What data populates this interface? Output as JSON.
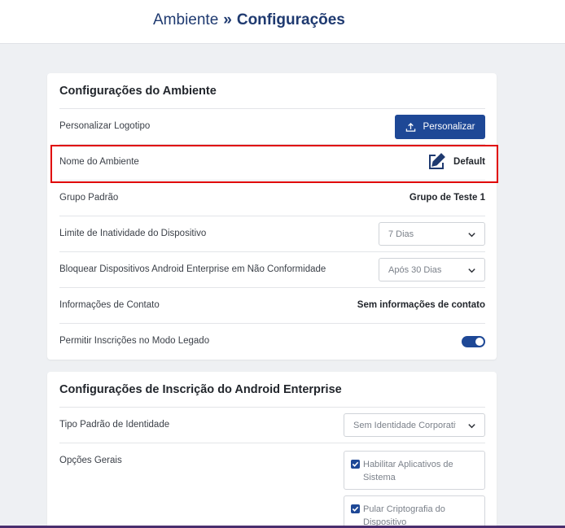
{
  "header": {
    "breadcrumb_parent": "Ambiente",
    "breadcrumb_separator": "»",
    "breadcrumb_current": "Configurações"
  },
  "environment_settings": {
    "title": "Configurações do Ambiente",
    "rows": {
      "logo": {
        "label": "Personalizar Logotipo",
        "button": "Personalizar",
        "icon": "upload-icon"
      },
      "name": {
        "label": "Nome do Ambiente",
        "value": "Default",
        "icon": "edit-icon"
      },
      "group": {
        "label": "Grupo Padrão",
        "value": "Grupo de Teste 1"
      },
      "inactivity": {
        "label": "Limite de Inatividade do Dispositivo",
        "selected": "7 Dias"
      },
      "block": {
        "label": "Bloquear Dispositivos Android Enterprise em Não Conformidade",
        "selected": "Após 30 Dias"
      },
      "contact": {
        "label": "Informações de Contato",
        "value": "Sem informações de contato"
      },
      "legacy": {
        "label": "Permitir Inscrições no Modo Legado",
        "toggle_on": true
      }
    }
  },
  "android_enrollment": {
    "title": "Configurações de Inscrição do Android Enterprise",
    "rows": {
      "identity": {
        "label": "Tipo Padrão de Identidade",
        "selected": "Sem Identidade Corporativa"
      },
      "general": {
        "label": "Opções Gerais",
        "options": [
          {
            "label": "Habilitar Aplicativos de Sistema",
            "checked": true
          },
          {
            "label": "Pular Criptografia do Dispositivo",
            "checked": true
          }
        ]
      }
    }
  },
  "colors": {
    "accent": "#1e4896",
    "header_text": "#1f3a70",
    "highlight": "#e00000"
  }
}
